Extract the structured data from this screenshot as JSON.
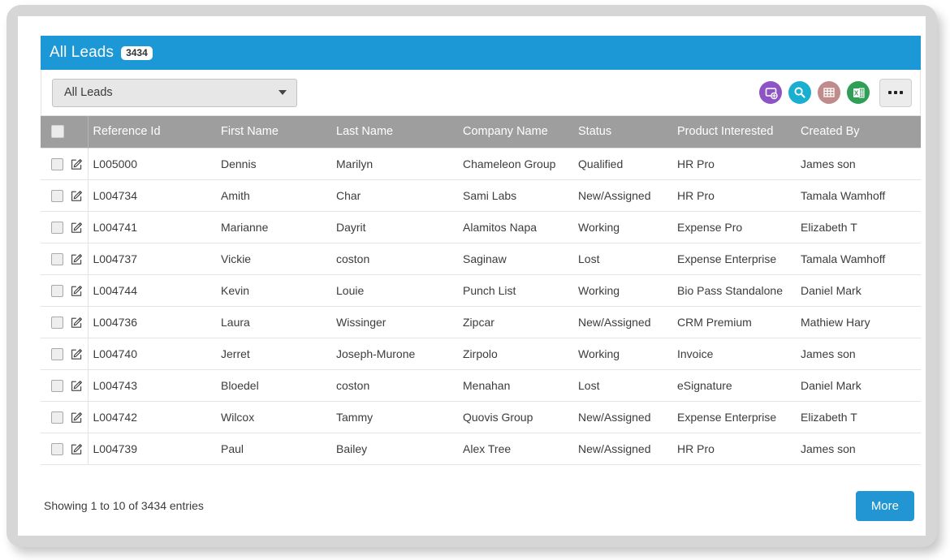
{
  "header": {
    "title": "All Leads",
    "count_badge": "3434"
  },
  "toolbar": {
    "view_selected": "All Leads",
    "caret_icon": "chevron-down-icon",
    "actions": [
      {
        "name": "new-record-icon",
        "color": "#8e53c4"
      },
      {
        "name": "search-icon",
        "color": "#1aafd0"
      },
      {
        "name": "grid-view-icon",
        "color": "#c08b8b"
      },
      {
        "name": "export-excel-icon",
        "color": "#2f9e56"
      }
    ],
    "more_menu_label": "",
    "more_menu_icon": "ellipsis-icon"
  },
  "table": {
    "columns": [
      "",
      "Reference Id",
      "First Name",
      "Last Name",
      "Company Name",
      "Status",
      "Product Interested",
      "Created By"
    ],
    "rows": [
      {
        "reference_id": "L005000",
        "first_name": "Dennis",
        "last_name": "Marilyn",
        "company_name": "Chameleon Group",
        "status": "Qualified",
        "product_interested": "HR Pro",
        "created_by": "James son"
      },
      {
        "reference_id": "L004734",
        "first_name": "Amith",
        "last_name": "Char",
        "company_name": "Sami Labs",
        "status": "New/Assigned",
        "product_interested": "HR Pro",
        "created_by": "Tamala Wamhoff"
      },
      {
        "reference_id": "L004741",
        "first_name": "Marianne",
        "last_name": "Dayrit",
        "company_name": "Alamitos Napa",
        "status": "Working",
        "product_interested": "Expense Pro",
        "created_by": "Elizabeth T"
      },
      {
        "reference_id": "L004737",
        "first_name": "Vickie",
        "last_name": "coston",
        "company_name": "Saginaw",
        "status": "Lost",
        "product_interested": "Expense Enterprise",
        "created_by": "Tamala Wamhoff"
      },
      {
        "reference_id": "L004744",
        "first_name": "Kevin",
        "last_name": "Louie",
        "company_name": "Punch List",
        "status": "Working",
        "product_interested": "Bio Pass Standalone",
        "created_by": "Daniel Mark"
      },
      {
        "reference_id": "L004736",
        "first_name": "Laura",
        "last_name": "Wissinger",
        "company_name": "Zipcar",
        "status": "New/Assigned",
        "product_interested": "CRM Premium",
        "created_by": "Mathiew Hary"
      },
      {
        "reference_id": "L004740",
        "first_name": "Jerret",
        "last_name": "Joseph-Murone",
        "company_name": "Zirpolo",
        "status": "Working",
        "product_interested": "Invoice",
        "created_by": "James son"
      },
      {
        "reference_id": "L004743",
        "first_name": "Bloedel",
        "last_name": "coston",
        "company_name": "Menahan",
        "status": "Lost",
        "product_interested": "eSignature",
        "created_by": "Daniel Mark"
      },
      {
        "reference_id": "L004742",
        "first_name": "Wilcox",
        "last_name": "Tammy",
        "company_name": "Quovis Group",
        "status": "New/Assigned",
        "product_interested": "Expense Enterprise",
        "created_by": "Elizabeth T"
      },
      {
        "reference_id": "L004739",
        "first_name": "Paul",
        "last_name": "Bailey",
        "company_name": "Alex Tree",
        "status": "New/Assigned",
        "product_interested": "HR Pro",
        "created_by": "James son"
      }
    ]
  },
  "footer": {
    "showing_text": "Showing 1 to 10 of 3434 entries",
    "more_label": "More"
  },
  "colors": {
    "header_blue": "#1b98d5",
    "button_blue": "#2196d3",
    "table_header_gray": "#9e9e9e"
  }
}
